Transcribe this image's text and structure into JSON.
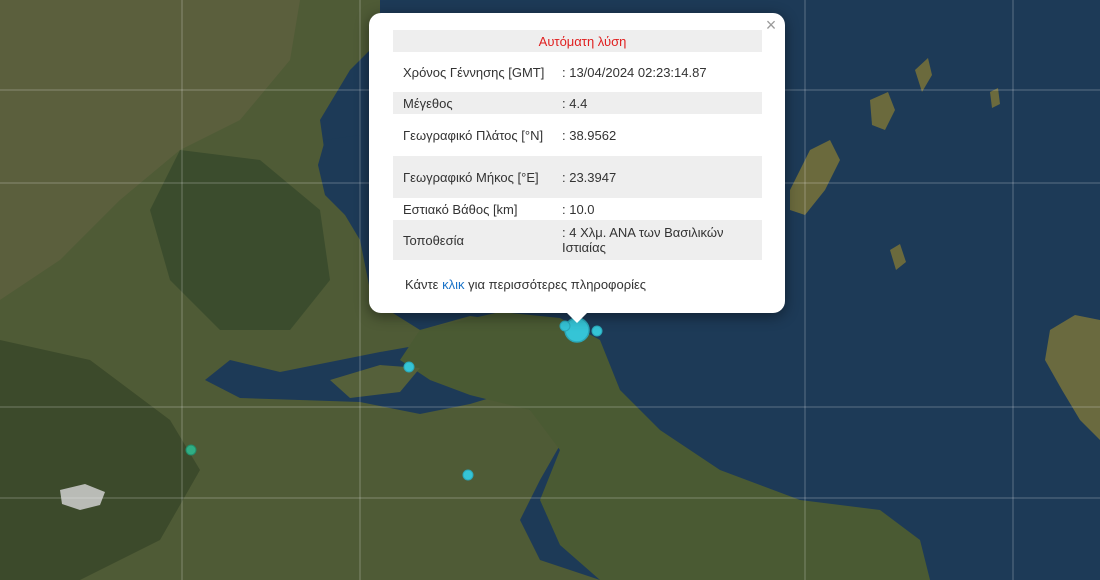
{
  "popup": {
    "header": "Αυτόματη λύση",
    "close_symbol": "×",
    "rows": [
      {
        "label": "Χρόνος Γέννησης [GMT]",
        "value": ": 13/04/2024 02:23:14.87"
      },
      {
        "label": "Μέγεθος",
        "value": ": 4.4"
      },
      {
        "label": "Γεωγραφικό Πλάτος [°N]",
        "value": ": 38.9562"
      },
      {
        "label": "Γεωγραφικό Μήκος [°E]",
        "value": ": 23.3947"
      },
      {
        "label": "Εστιακό Βάθος [km]",
        "value": ": 10.0"
      },
      {
        "label": "Τοποθεσία",
        "value": ": 4 Χλμ. ΑΝΑ των Βασιλικών Ιστιαίας"
      }
    ],
    "footer_before": "Κάντε ",
    "footer_link": "κλικ",
    "footer_after": " για περισσότερες πληροφορίες"
  },
  "colors": {
    "sea": "#1d3a57",
    "land": "#4d5a35",
    "quake_marker": "#35c4d6",
    "quake_marker_green": "#2fae84",
    "header_red": "#e02020",
    "link_blue": "#1a73c8"
  },
  "markers": [
    {
      "name": "quake-marker-main",
      "magnitude_class": "large"
    },
    {
      "name": "quake-marker-small-1"
    },
    {
      "name": "quake-marker-small-2"
    },
    {
      "name": "quake-marker-small-3"
    },
    {
      "name": "quake-marker-small-4"
    },
    {
      "name": "quake-marker-green"
    }
  ]
}
